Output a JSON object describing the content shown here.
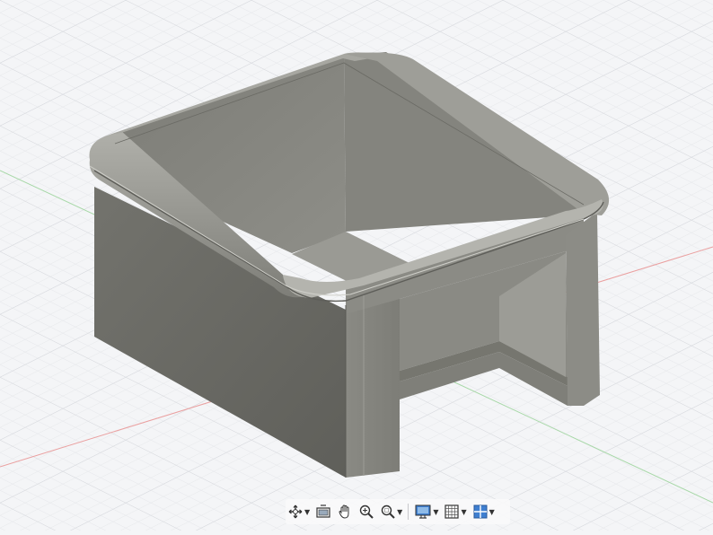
{
  "app": {
    "name": "3D CAD canvas"
  },
  "colors": {
    "background": "#f4f5f7",
    "grid_minor": "#e3e5e8",
    "grid_major": "#d3d6da",
    "axis_x": "#e9a0a0",
    "axis_y": "#9fd49f",
    "body_light": "#8d8d86",
    "body_dark": "#6c6c66",
    "accent_blue": "#3f7fd0"
  },
  "toolbar": {
    "items": [
      {
        "icon": "orbit-icon",
        "has_dropdown": true
      },
      {
        "icon": "look-at-icon",
        "has_dropdown": false
      },
      {
        "icon": "pan-hand-icon",
        "has_dropdown": false
      },
      {
        "icon": "zoom-icon",
        "has_dropdown": false
      },
      {
        "icon": "fit-zoom-icon",
        "has_dropdown": true
      },
      {
        "icon": "display-settings-icon",
        "has_dropdown": true
      },
      {
        "icon": "grid-snap-icon",
        "has_dropdown": true
      },
      {
        "icon": "viewports-icon",
        "has_dropdown": true
      }
    ]
  }
}
